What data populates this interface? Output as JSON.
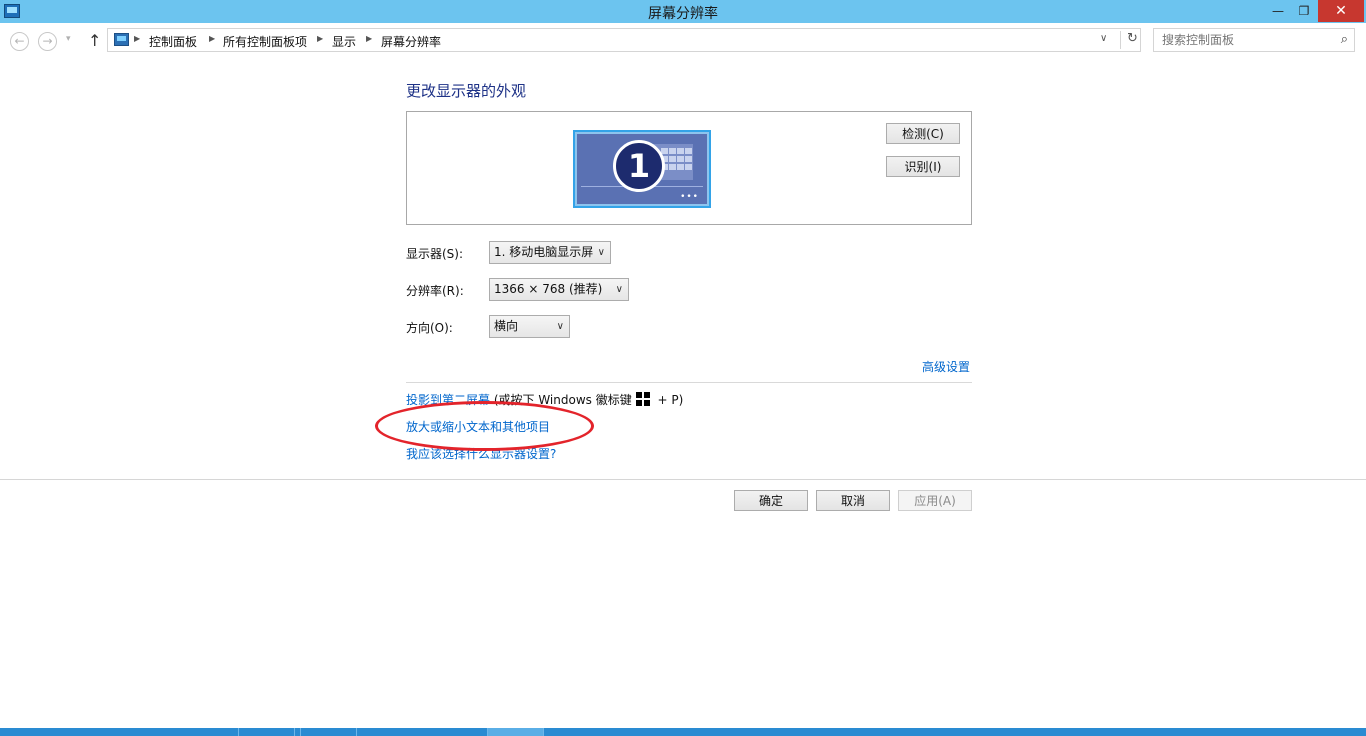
{
  "window": {
    "title": "屏幕分辨率",
    "minimize": "—",
    "maximize": "❐",
    "close": "✕"
  },
  "nav": {
    "back": "←",
    "forward": "→",
    "recent": "▾",
    "up": "↑"
  },
  "breadcrumb": {
    "items": [
      "控制面板",
      "所有控制面板项",
      "显示",
      "屏幕分辨率"
    ],
    "separator": "▶",
    "dropdown": "∨",
    "refresh": "↻"
  },
  "search": {
    "placeholder": "搜索控制面板",
    "icon": "⌕"
  },
  "main": {
    "heading": "更改显示器的外观",
    "monitor_number": "1",
    "monitor_dots": "•••",
    "detect_button": "检测(C)",
    "identify_button": "识别(I)",
    "display_label": "显示器(S):",
    "display_value": "1. 移动电脑显示屏",
    "resolution_label": "分辨率(R):",
    "resolution_value": "1366 × 768 (推荐)",
    "orientation_label": "方向(O):",
    "orientation_value": "横向",
    "caret": "∨",
    "advanced_link": "高级设置",
    "project_link": "投影到第二屏幕",
    "project_hint_before": " (或按下 Windows 徽标键",
    "project_hint_after": " + P)",
    "scale_link": "放大或缩小文本和其他项目",
    "which_settings_link": "我应该选择什么显示器设置?"
  },
  "footer": {
    "ok": "确定",
    "cancel": "取消",
    "apply": "应用(A)"
  },
  "colors": {
    "titlebar": "#6cc4ef",
    "link": "#0066cc",
    "heading": "#1e3287",
    "highlight_ellipse": "#e3242b",
    "taskbar": "#2a8bd2"
  }
}
